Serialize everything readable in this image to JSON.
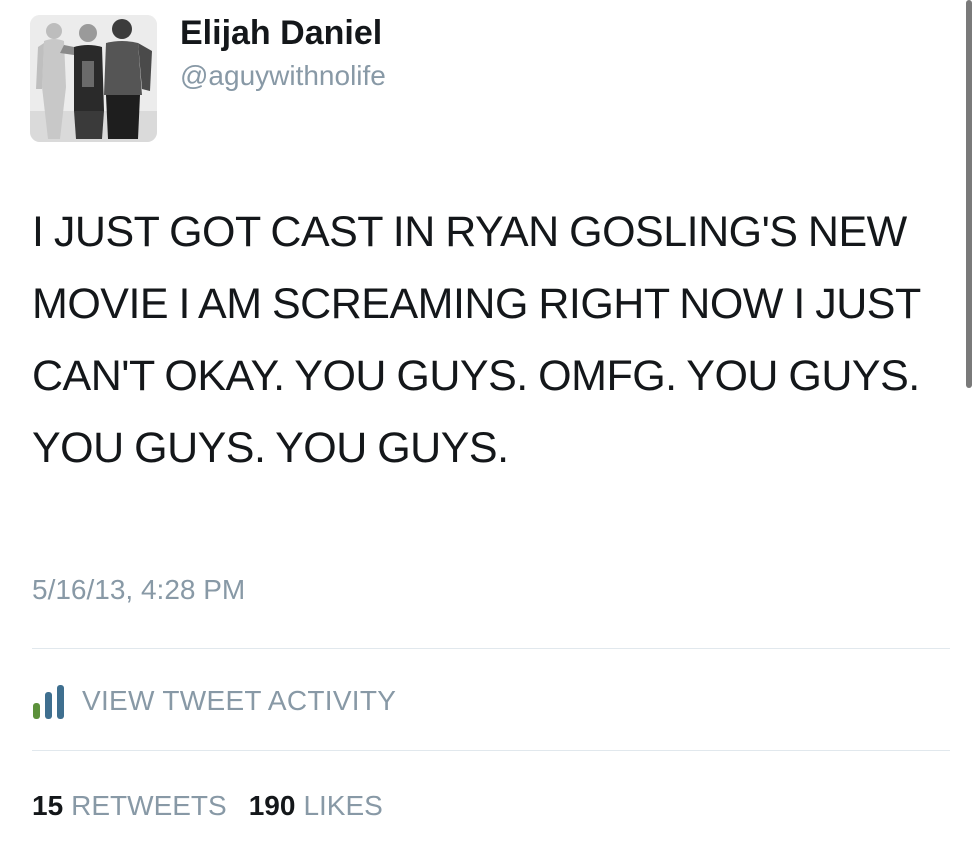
{
  "user": {
    "display_name": "Elijah Daniel",
    "handle": "@aguywithnolife",
    "avatar_icon": "profile-photo"
  },
  "tweet": {
    "text": "I JUST GOT CAST IN RYAN GOSLING'S NEW MOVIE I AM SCREAMING RIGHT NOW I JUST CAN'T OKAY. YOU GUYS. OMFG. YOU GUYS. YOU GUYS. YOU GUYS.",
    "timestamp": "5/16/13, 4:28 PM"
  },
  "activity": {
    "icon": "bar-chart-icon",
    "label": "VIEW TWEET ACTIVITY"
  },
  "stats": {
    "retweets_count": "15",
    "retweets_label": "RETWEETS",
    "likes_count": "190",
    "likes_label": "LIKES"
  },
  "colors": {
    "text_primary": "#14171a",
    "text_secondary": "#8899a6",
    "divider": "#e1e8ed",
    "background": "#ffffff"
  }
}
